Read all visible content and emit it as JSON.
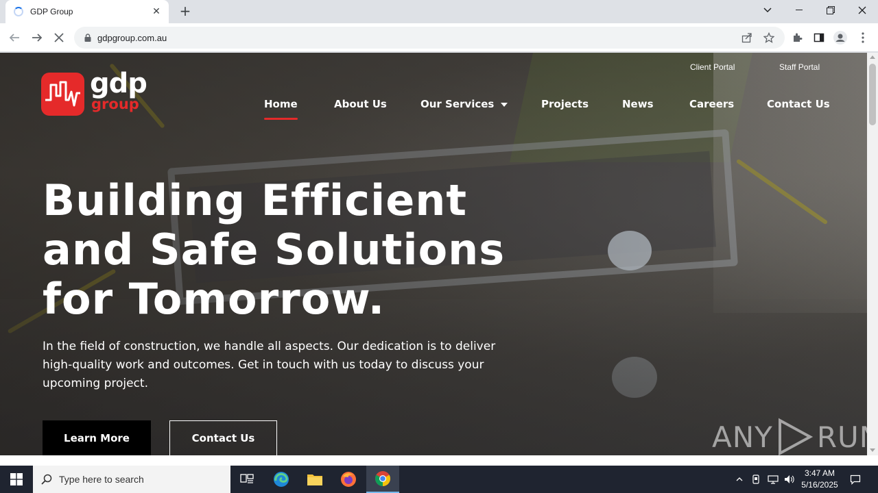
{
  "browser": {
    "tab_title": "GDP Group",
    "url": "gdpgroup.com.au"
  },
  "site": {
    "logo": {
      "primary": "gdp",
      "secondary": "group"
    },
    "top_links": {
      "client_portal": "Client Portal",
      "staff_portal": "Staff Portal"
    },
    "nav": [
      {
        "label": "Home",
        "active": true
      },
      {
        "label": "About Us"
      },
      {
        "label": "Our Services",
        "has_dropdown": true
      },
      {
        "label": "Projects"
      },
      {
        "label": "News"
      },
      {
        "label": "Careers"
      },
      {
        "label": "Contact Us"
      }
    ],
    "hero": {
      "headline": [
        "Building Efficient",
        "and Safe Solutions",
        "for Tomorrow."
      ],
      "lede_lines": [
        "In the field of construction, we handle all aspects. Our dedication is to deliver",
        "high-quality work and outcomes. Get in touch with us today to discuss your",
        "upcoming project."
      ],
      "primary_cta": "Learn More",
      "secondary_cta": "Contact Us"
    },
    "watermark": {
      "left": "ANY",
      "right": "RUN"
    },
    "colors": {
      "brand_red": "#e52a2a",
      "cta_black": "#000000"
    }
  },
  "taskbar": {
    "search_placeholder": "Type here to search",
    "time": "3:47 AM",
    "date": "5/16/2025"
  }
}
